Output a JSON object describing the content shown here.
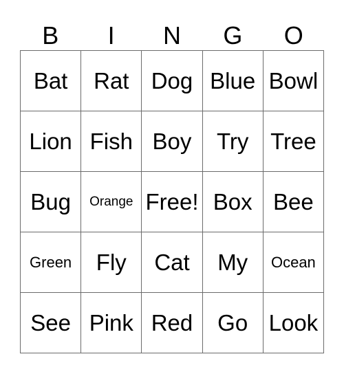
{
  "card": {
    "header": [
      "B",
      "I",
      "N",
      "G",
      "O"
    ],
    "rows": [
      [
        "Bat",
        "Rat",
        "Dog",
        "Blue",
        "Bowl"
      ],
      [
        "Lion",
        "Fish",
        "Boy",
        "Try",
        "Tree"
      ],
      [
        "Bug",
        "Orange",
        "Free!",
        "Box",
        "Bee"
      ],
      [
        "Green",
        "Fly",
        "Cat",
        "My",
        "Ocean"
      ],
      [
        "See",
        "Pink",
        "Red",
        "Go",
        "Look"
      ]
    ],
    "free_space": "Free!"
  },
  "colors": {
    "text": "#000000",
    "grid_line": "#6b6b6b",
    "background": "#ffffff"
  }
}
